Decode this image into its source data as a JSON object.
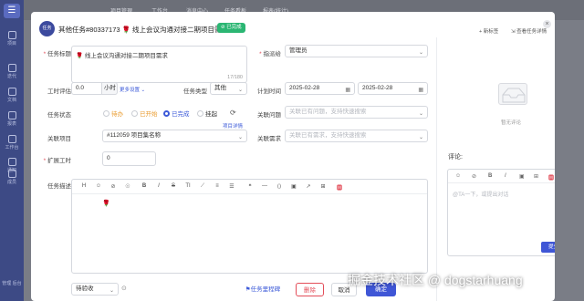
{
  "app": {
    "top_tabs": [
      "项目管理",
      "工作台",
      "消息中心",
      "任务看板",
      "报表(统计)"
    ],
    "sidebar": [
      {
        "label": "项目"
      },
      {
        "label": "迭代"
      },
      {
        "label": "文档"
      },
      {
        "label": "报表"
      },
      {
        "label": "工作台"
      },
      {
        "label": "通知"
      },
      {
        "label": "成员"
      }
    ],
    "sidebar_footer": "管理\n后台"
  },
  "modal": {
    "type_badge": "任务",
    "title": "其他任务#80337173 🌹 线上会议沟通对接二期项目需求",
    "status_tag": "⊘ 已完成",
    "actions": {
      "new_tab": "新标签",
      "view_detail": "查看任务详情"
    },
    "close": "×"
  },
  "form": {
    "task_title_label": "任务标题",
    "task_title_value": "🌹 线上会议沟通对接二期项目需求",
    "task_title_counter": "17/180",
    "assignee_label": "指派给",
    "assignee_value": "管理员",
    "estimate_label": "工时评估",
    "estimate_value": "0.0",
    "estimate_unit": "小时",
    "more_settings": "更多设置",
    "task_type_label": "任务类型",
    "task_type_value": "其他",
    "plan_time_label": "计划时间",
    "plan_start": "2025-02-28",
    "plan_end": "2025-02-28",
    "status_label": "任务状态",
    "status_options": [
      {
        "label": "待办",
        "color": "#e99a2c"
      },
      {
        "label": "已开始",
        "color": "#e99a2c"
      },
      {
        "label": "已完成",
        "color": "#3b59d8",
        "checked": true
      },
      {
        "label": "挂起",
        "color": "#333333"
      }
    ],
    "related_issue_label": "关联问题",
    "related_issue_placeholder": "关联已有问题，支持快速搜索",
    "project_detail_link": "项目详情",
    "project_label": "关联项目",
    "project_value": "#112059 项目集名称",
    "related_req_label": "关联需求",
    "related_req_placeholder": "关联已有需求，支持快速搜索",
    "expand_hours_label": "扩展工时",
    "expand_hours_value": "0",
    "desc_label": "任务描述",
    "desc_value": "🌹",
    "editor_tools": [
      "H",
      "☺",
      "⊘",
      "☉",
      "B",
      "I",
      "S",
      "TI",
      "⟋",
      "≡",
      "☰",
      "❝",
      "—",
      "⟨⟩",
      "▣",
      "↗",
      "⊞",
      "🅼"
    ]
  },
  "right": {
    "empty_text": "暂无评论",
    "comment_title": "评论:",
    "comment_tools": [
      "☺",
      "⊘",
      "B",
      "I",
      "▣",
      "⊞",
      "🅼"
    ],
    "comment_placeholder": "@TA一下，或提出对话",
    "submit": "提交评论"
  },
  "footer": {
    "stage_value": "待验收",
    "milestone": "⚑任务里程碑",
    "delete": "删除",
    "cancel": "取消",
    "confirm": "确定"
  },
  "watermark": "掘金技术社区 @ dogstarhuang",
  "colors": {
    "primary": "#3f56d6",
    "success": "#2bb673",
    "danger": "#e34d59",
    "warning": "#e99a2c"
  }
}
